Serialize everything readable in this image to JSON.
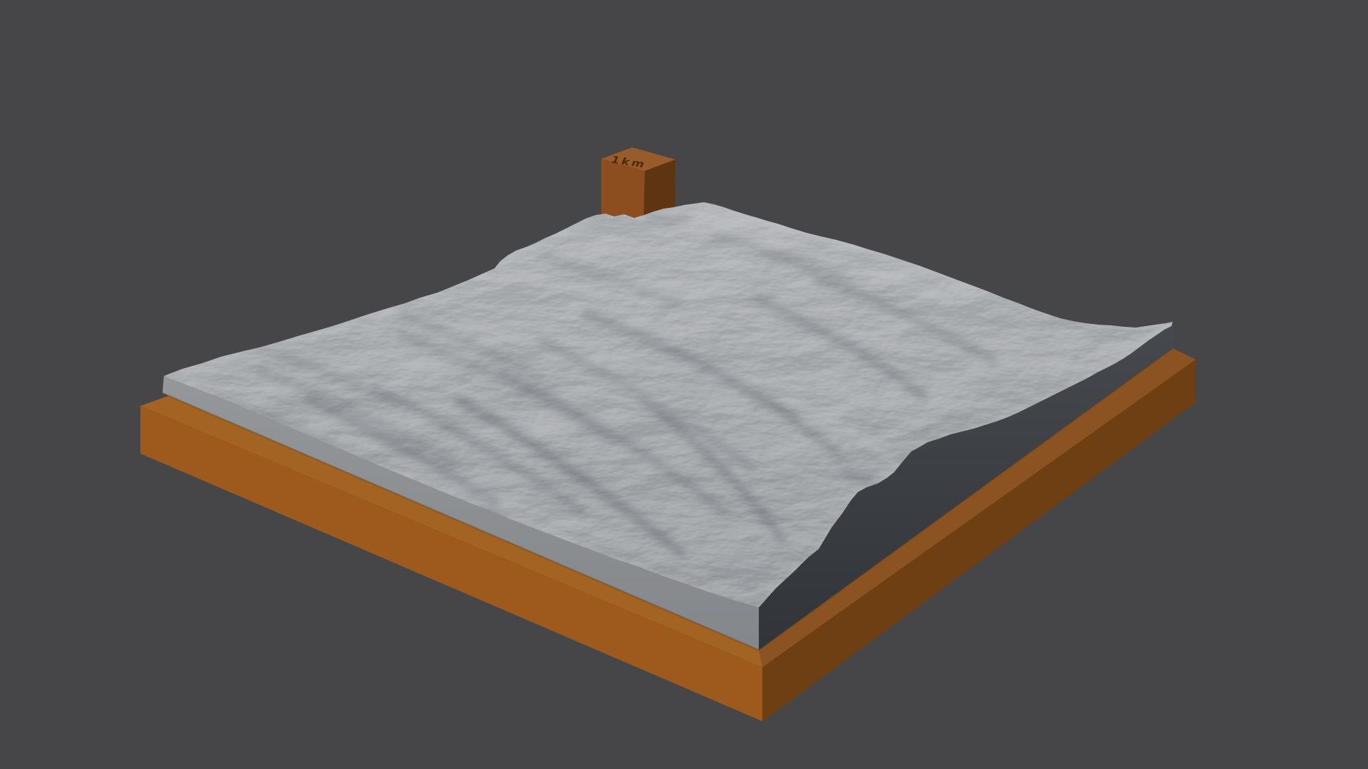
{
  "scene": {
    "type": "3d-terrain-relief-model-render",
    "background_color": "#464648"
  },
  "marker_block": {
    "label": "1km",
    "front_color": "#8d4e1f",
    "side_color": "#5e3413",
    "top_color": "#975c2a",
    "text_color": "#3f2207"
  },
  "base": {
    "rim_color": "#a36423",
    "rim_right_color": "#8c5322",
    "front_left_color": "#9d5a1c",
    "front_right_color": "#6f3f14"
  },
  "terrain": {
    "surface_back_color": "#a9acae",
    "surface_front_color": "#8f9397",
    "left_wall_top_color": "#949799",
    "left_wall_bottom_color": "#83868a",
    "right_wall_top_color": "#46494e",
    "right_wall_bottom_color": "#303338",
    "ridge_shadow_color": "#555b63",
    "ridge_light_color": "#c2c5c7",
    "edge_light_color": "#bcbfc1"
  }
}
